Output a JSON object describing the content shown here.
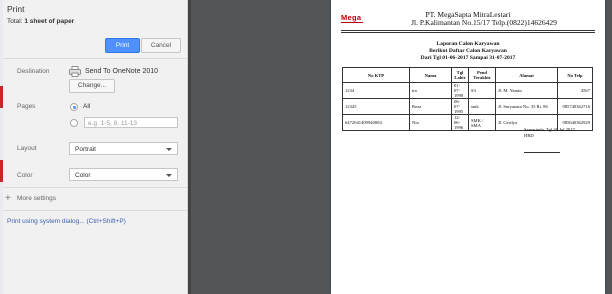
{
  "print_panel": {
    "title": "Print",
    "total_label": "Total:",
    "total_value": "1 sheet of paper",
    "print_label": "Print",
    "cancel_label": "Cancel",
    "destination": {
      "label": "Destination",
      "value": "Send To OneNote 2010",
      "change_label": "Change..."
    },
    "pages": {
      "label": "Pages",
      "all_label": "All",
      "range_placeholder": "e.g. 1-5, 8, 11-13"
    },
    "layout": {
      "label": "Layout",
      "value": "Portrait"
    },
    "color": {
      "label": "Color",
      "value": "Color"
    },
    "more_settings": "More settings",
    "system_dialog": "Print using system dialog... (Ctrl+Shift+P)"
  },
  "preview": {
    "logo": "Mega",
    "company_line1": "PT. MegaSapta MitraLestari",
    "company_line2": "Jl. P.Kalimantan No.15/17 Telp.(0822)14626429",
    "report_title": "Laporan Calon Karyawan",
    "report_subtitle": "Berikut Daftar Calon Karyawan",
    "report_period": "Dari Tgl 01-06-2017 Sampai 31-07-2017",
    "table": {
      "headers": [
        "No KTP",
        "Nama",
        "Tgl Lahir",
        "Pend Terakhir",
        "Alamat",
        "No Telp"
      ],
      "rows": [
        [
          "1234",
          "ira",
          "01-07-1998",
          "S3",
          "Jl. M. Yamin",
          "4567"
        ],
        [
          "12345",
          "Reza",
          "06-07-1995",
          "smk",
          "Jl. Suryanata No. 35 Rt. 86",
          "085740362716"
        ],
        [
          "6472041409940004",
          "Nia",
          "12-06-1996",
          "SMK / SMA",
          "Jl. Gerilya",
          "085640362929"
        ]
      ]
    },
    "sign_place_date": "Samarinda, Tgl 26 Jul 2017",
    "sign_role": "HRD"
  }
}
